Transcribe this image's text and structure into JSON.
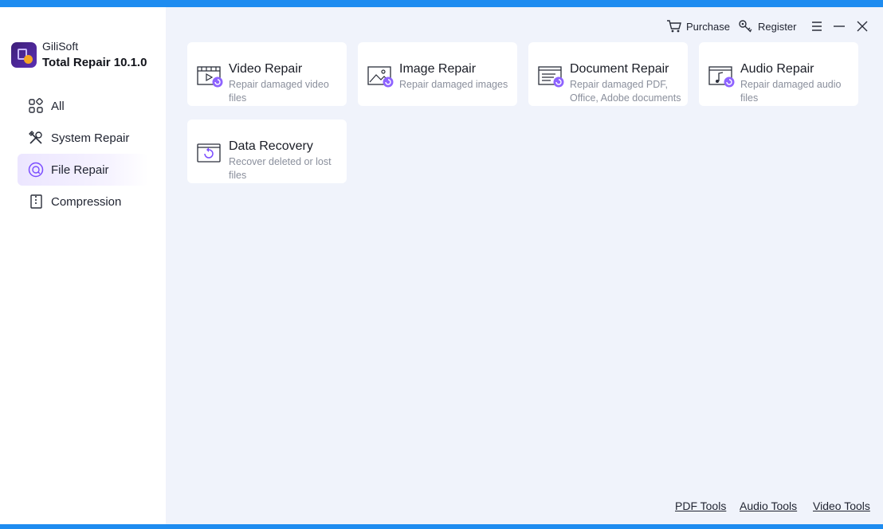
{
  "app": {
    "brand": "GiliSoft",
    "product": "Total Repair 10.1.0"
  },
  "topbar": {
    "purchase_label": "Purchase",
    "register_label": "Register"
  },
  "sidebar": {
    "items": [
      {
        "label": "All",
        "icon": "grid-icon",
        "active": false
      },
      {
        "label": "System Repair",
        "icon": "tools-icon",
        "active": false
      },
      {
        "label": "File Repair",
        "icon": "file-repair-icon",
        "active": true
      },
      {
        "label": "Compression",
        "icon": "zip-file-icon",
        "active": false
      }
    ]
  },
  "cards": [
    {
      "title": "Video Repair",
      "desc": "Repair damaged video files",
      "icon": "video-repair-icon"
    },
    {
      "title": "Image Repair",
      "desc": "Repair damaged images",
      "icon": "image-repair-icon"
    },
    {
      "title": "Document Repair",
      "desc": "Repair damaged PDF, Office, Adobe documents",
      "icon": "document-repair-icon"
    },
    {
      "title": "Audio Repair",
      "desc": "Repair damaged audio files",
      "icon": "audio-repair-icon"
    },
    {
      "title": "Data Recovery",
      "desc": "Recover deleted or lost files",
      "icon": "data-recovery-icon"
    }
  ],
  "footer": {
    "links": [
      "PDF Tools",
      "Audio Tools",
      "Video Tools"
    ]
  },
  "colors": {
    "accent": "#7b4dff",
    "sidebar_active_bg": "#ece6ff",
    "content_bg": "#f0f3fb",
    "desktop_border": "#1e8cf0"
  }
}
